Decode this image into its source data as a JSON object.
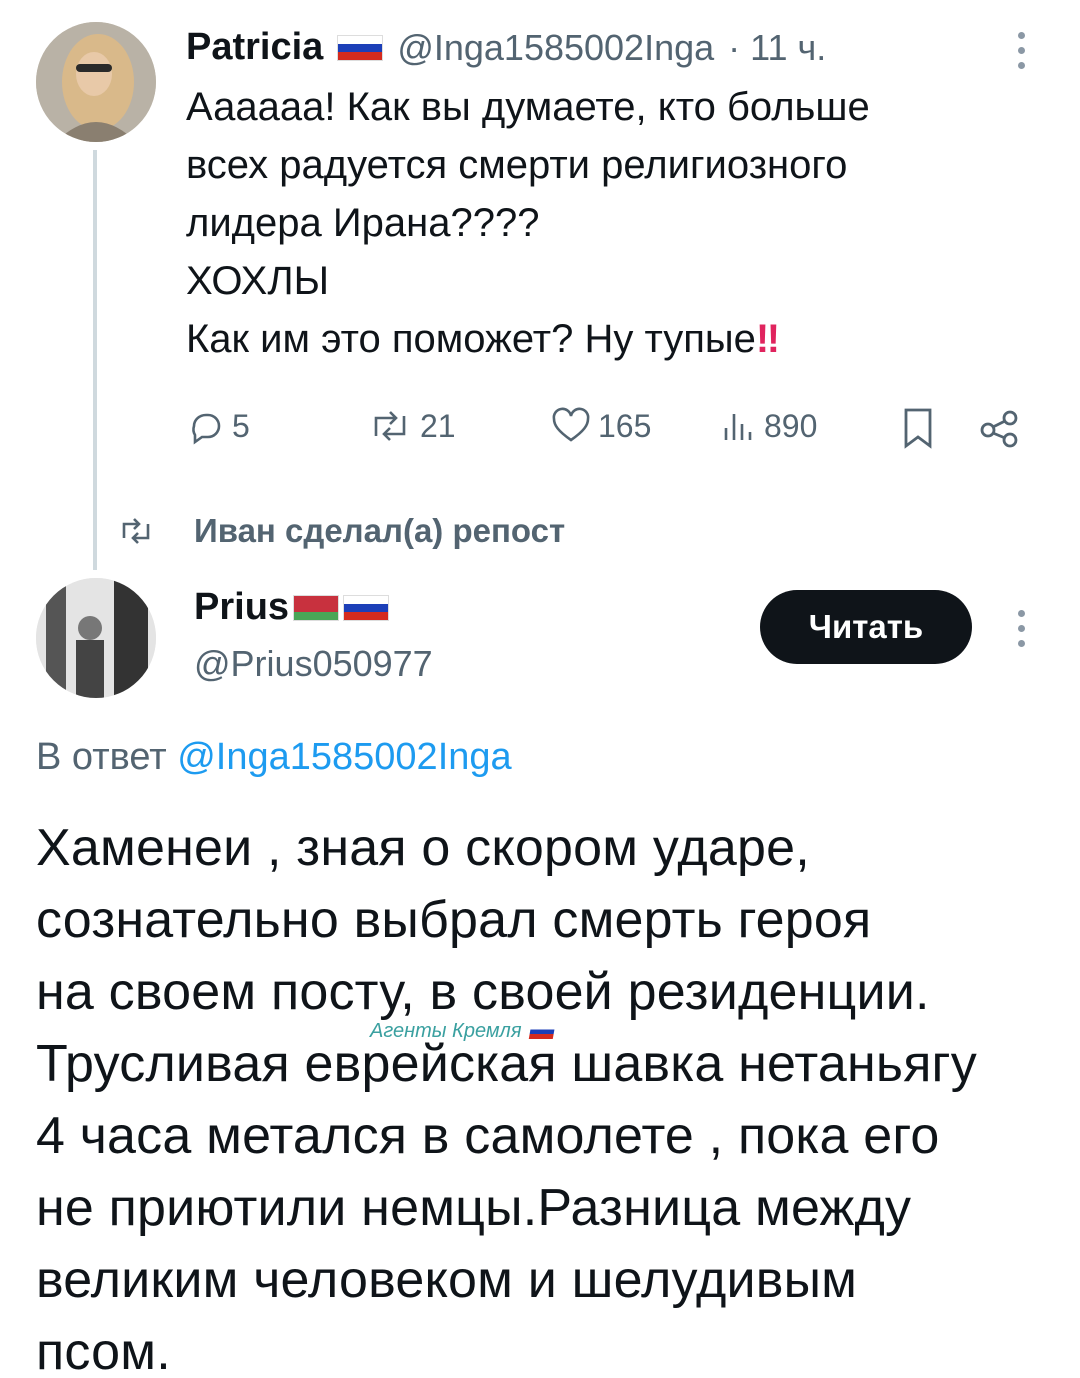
{
  "tweet1": {
    "name": "Patricia",
    "handle": "@Inga1585002Inga",
    "time": "· 11 ч.",
    "lines": [
      "Аааааа! Как вы думаете, кто больше",
      "всех радуется смерти религиозного",
      "лидера Ирана????",
      "ХОХЛЫ",
      "Как им это поможет? Ну тупые"
    ],
    "exclaim": "‼",
    "actions": {
      "replies": "5",
      "reposts": "21",
      "likes": "165",
      "views": "890"
    }
  },
  "repost_line": "Иван сделал(а) репост",
  "tweet2": {
    "name": "Prius",
    "handle": "@Prius050977",
    "follow_label": "Читать",
    "reply_prefix": "В ответ",
    "reply_handle": "@Inga1585002Inga",
    "lines": [
      "Хаменеи , зная о скором ударе,",
      "сознательно выбрал смерть героя",
      "на своем посту, в своей резиденции.",
      "Трусливая еврейская шавка нетаньягу",
      "4 часа метался в самолете , пока его",
      "не приютили немцы.Разница между",
      "великим человеком и шелудивым",
      "псом."
    ]
  },
  "watermark": "Агенты Кремля",
  "colors": {
    "text": "#0f1419",
    "secondary": "#536471",
    "link": "#1d9bf0",
    "button_bg": "#0f1419"
  },
  "icons": [
    "reply-icon",
    "repost-icon",
    "like-icon",
    "views-icon",
    "bookmark-icon",
    "share-icon",
    "more-icon",
    "russia-flag-icon",
    "belarus-flag-icon"
  ]
}
